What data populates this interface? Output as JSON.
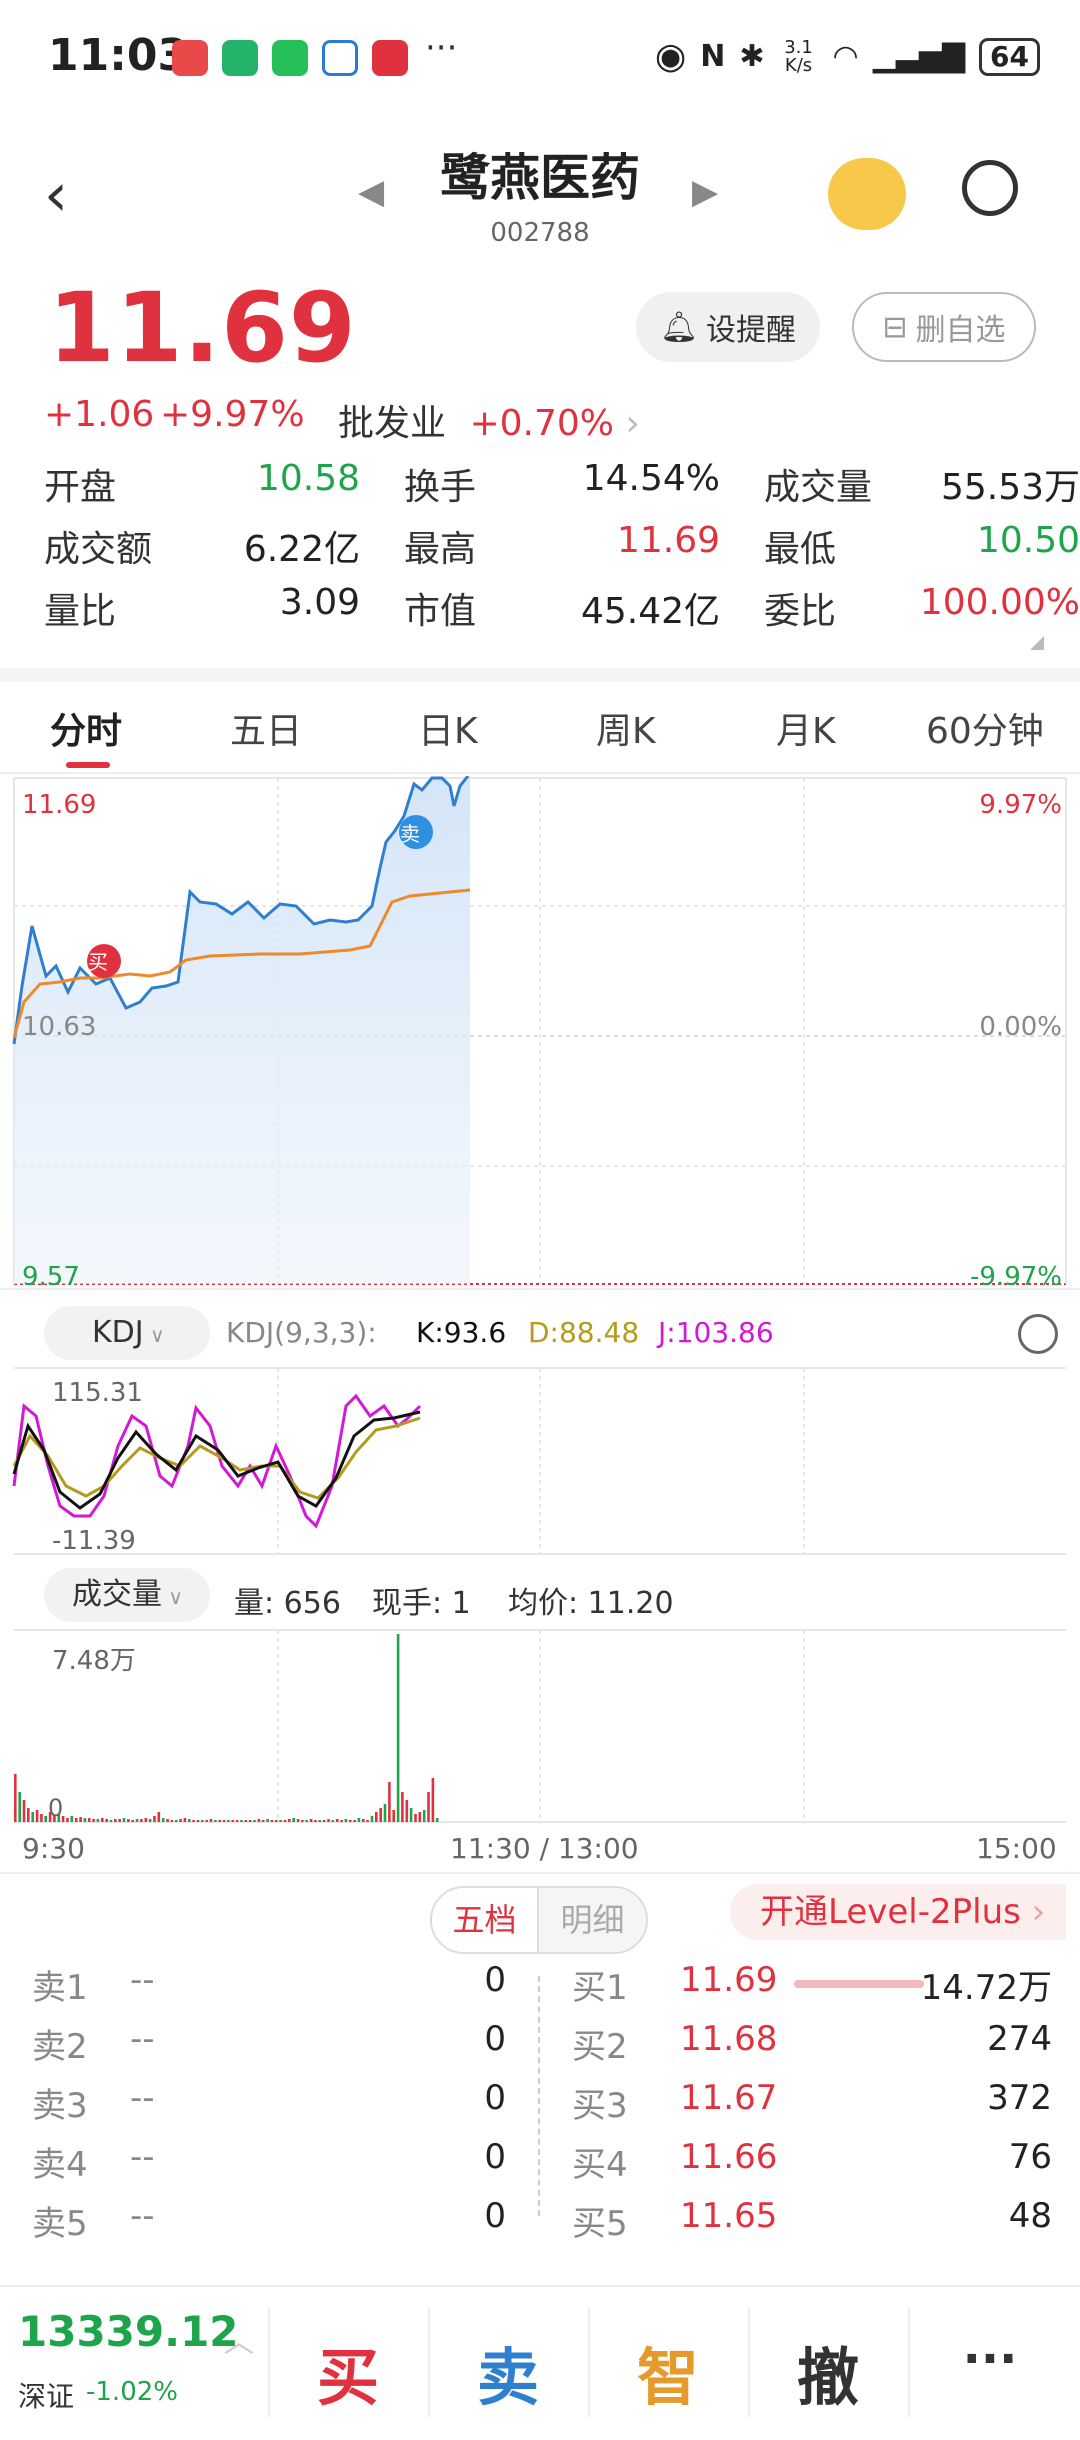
{
  "status_bar": {
    "time": "11:03",
    "net_speed": "3.1 K/s",
    "battery": "64",
    "more": "···"
  },
  "header": {
    "stock_name": "鹭燕医药",
    "stock_code": "002788"
  },
  "quote": {
    "price": "11.69",
    "change": "+1.06",
    "change_pct": "+9.97%",
    "sector_name": "批发业",
    "sector_change": "+0.70%",
    "alert_label": "设提醒",
    "remove_watch_label": "删自选"
  },
  "stats": {
    "open_label": "开盘",
    "open": "10.58",
    "turnover_label": "换手",
    "turnover": "14.54%",
    "volume_label": "成交量",
    "volume": "55.53万",
    "amount_label": "成交额",
    "amount": "6.22亿",
    "high_label": "最高",
    "high": "11.69",
    "low_label": "最低",
    "low": "10.50",
    "vol_ratio_label": "量比",
    "vol_ratio": "3.09",
    "mktcap_label": "市值",
    "mktcap": "45.42亿",
    "order_ratio_label": "委比",
    "order_ratio": "100.00%"
  },
  "tabs": [
    "分时",
    "五日",
    "日K",
    "周K",
    "月K",
    "60分钟"
  ],
  "intraday": {
    "y_top": "11.69",
    "y_mid": "10.63",
    "y_bot": "9.57",
    "pct_top": "9.97%",
    "pct_mid": "0.00%",
    "pct_bot": "-9.97%",
    "buy_marker": "买",
    "sell_marker": "卖"
  },
  "kdj": {
    "selector": "KDJ",
    "params": "KDJ(9,3,3):",
    "k": "K:93.6",
    "d": "D:88.48",
    "j": "J:103.86",
    "y_top": "115.31",
    "y_bot": "-11.39",
    "colors": {
      "k": "#111111",
      "d": "#b59a1e",
      "j": "#d21ad6"
    }
  },
  "volume_panel": {
    "selector": "成交量",
    "qty": "量: 656",
    "hand": "现手: 1",
    "avg": "均价: 11.20",
    "y_top": "7.48万",
    "y_bot": "0"
  },
  "time_axis": {
    "start": "9:30",
    "mid": "11:30 / 13:00",
    "end": "15:00"
  },
  "orderbook": {
    "tab_five": "五档",
    "tab_detail": "明细",
    "level2": "开通Level-2Plus",
    "sell": [
      {
        "label": "卖1",
        "price": "--",
        "qty": "0"
      },
      {
        "label": "卖2",
        "price": "--",
        "qty": "0"
      },
      {
        "label": "卖3",
        "price": "--",
        "qty": "0"
      },
      {
        "label": "卖4",
        "price": "--",
        "qty": "0"
      },
      {
        "label": "卖5",
        "price": "--",
        "qty": "0"
      }
    ],
    "buy": [
      {
        "label": "买1",
        "price": "11.69",
        "qty": "14.72万"
      },
      {
        "label": "买2",
        "price": "11.68",
        "qty": "274"
      },
      {
        "label": "买3",
        "price": "11.67",
        "qty": "372"
      },
      {
        "label": "买4",
        "price": "11.66",
        "qty": "76"
      },
      {
        "label": "买5",
        "price": "11.65",
        "qty": "48"
      }
    ]
  },
  "bottom_bar": {
    "index_value": "13339.12",
    "index_name": "深证",
    "index_change": "-1.02%",
    "buy": "买",
    "sell": "卖",
    "smart": "智",
    "cancel": "撤",
    "more": "···"
  },
  "colors": {
    "up": "#e0323e",
    "down": "#1ea44a",
    "price_line": "#2f7fd1",
    "avg_line": "#ee8a2a"
  }
}
